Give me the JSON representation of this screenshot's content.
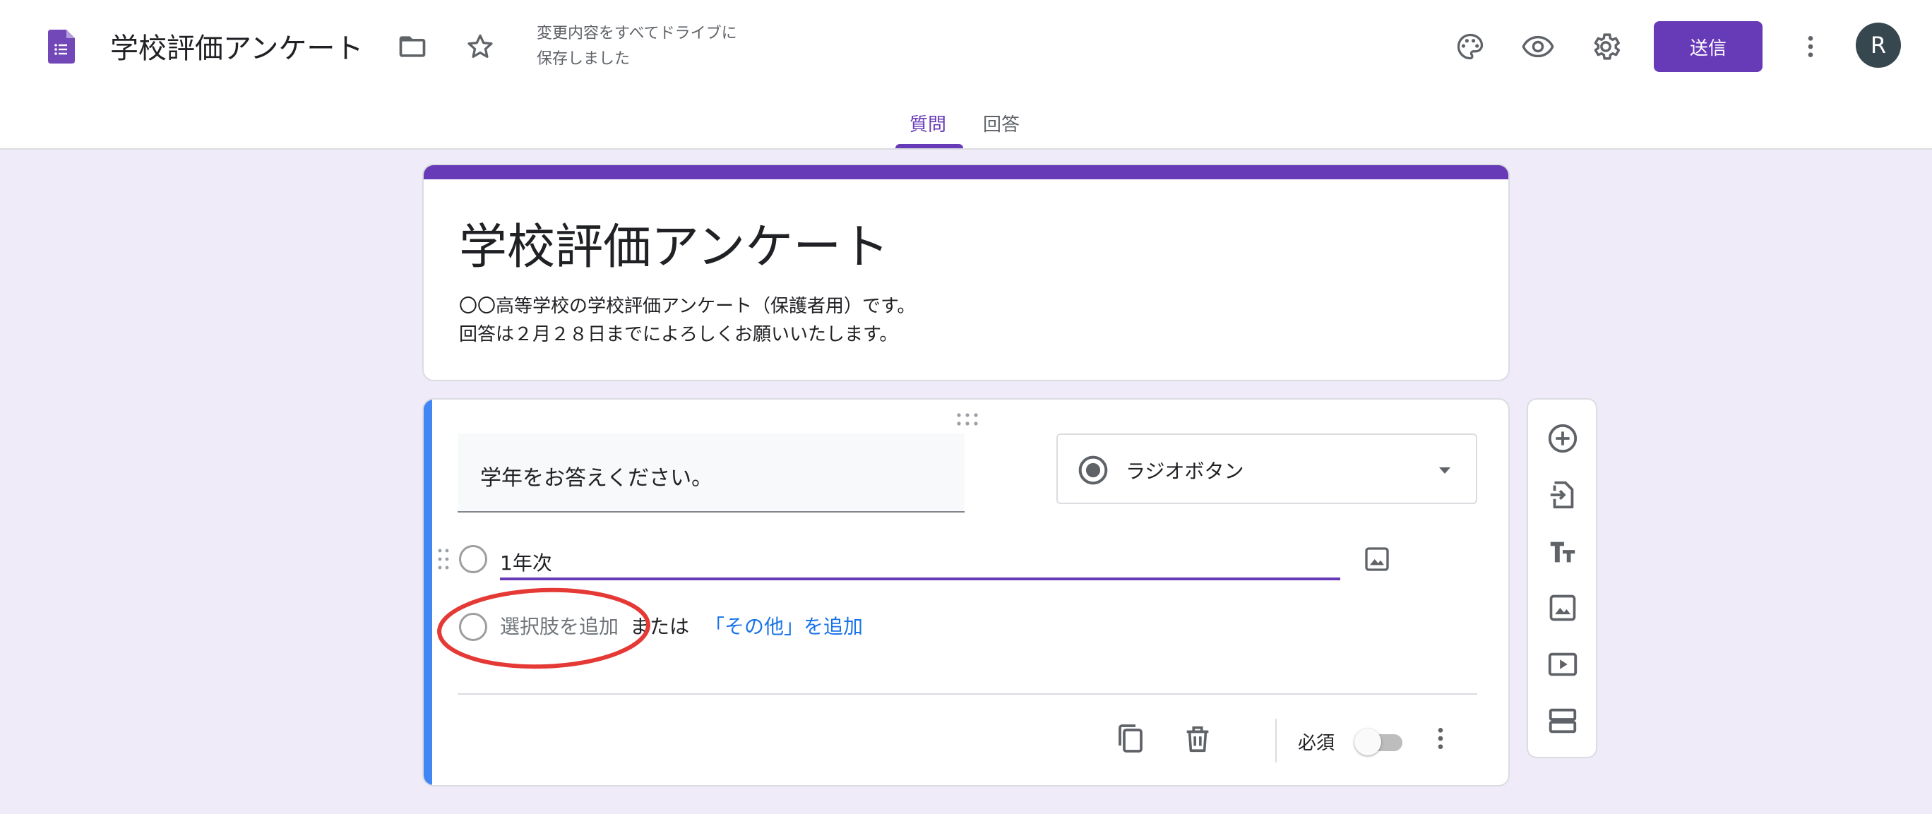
{
  "header": {
    "doc_title": "学校評価アンケート",
    "save_status_line1": "変更内容をすべてドライブに",
    "save_status_line2": "保存しました",
    "send_label": "送信",
    "avatar_letter": "R"
  },
  "tabs": [
    {
      "label": "質問",
      "active": true
    },
    {
      "label": "回答",
      "active": false
    }
  ],
  "form": {
    "title": "学校評価アンケート",
    "description_line1": "〇〇高等学校の学校評価アンケート（保護者用）です。",
    "description_line2": "回答は２月２８日までによろしくお願いいたします。"
  },
  "question": {
    "text": "学年をお答えください。",
    "type_label": "ラジオボタン",
    "options": [
      {
        "value": "1年次"
      }
    ],
    "add_option_label": "選択肢を追加",
    "or_label": "または",
    "add_other_label": "「その他」を追加",
    "required_label": "必須",
    "required": false
  },
  "icons": {
    "header": [
      "forms-logo-icon",
      "folder-icon",
      "star-icon",
      "palette-icon",
      "preview-eye-icon",
      "settings-gear-icon",
      "more-vert-icon"
    ],
    "side_toolbar": [
      "add-question-icon",
      "import-questions-icon",
      "add-title-icon",
      "add-image-icon",
      "add-video-icon",
      "add-section-icon"
    ]
  },
  "colors": {
    "accent": "#673ab7",
    "question_accent": "#4285f4",
    "link": "#1a73e8",
    "annotation": "#e53935",
    "background": "#f0ebf8"
  }
}
